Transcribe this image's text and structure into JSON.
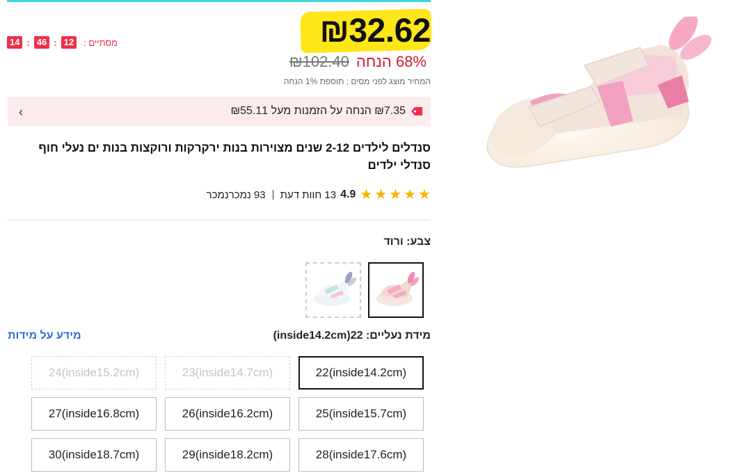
{
  "countdown": {
    "label": "מסתיים :",
    "hours": "14",
    "minutes": "46",
    "seconds": "12"
  },
  "price": {
    "current": "₪32.62",
    "original": "₪102.40",
    "discount": "68% הנחה",
    "tax_note": "המחיר מוצג לפני מסים ; תוספת 1% הנחה"
  },
  "coupon": {
    "text": "₪7.35 הנחה על הזמנות מעל ₪55.11",
    "icon": "tag-icon"
  },
  "product": {
    "title": "סנדלים לילדים 2-12 שנים מצוירות בנות ירקרקות ורוקצות בנות ים נעלי חוף סנדלי ילדים",
    "rating": "4.9",
    "reviews": "13 חוות דעת",
    "sold": "93 נמכרנמכר",
    "stars": 5
  },
  "color": {
    "label": "צבע: ורוד",
    "options": [
      "pink",
      "white-blue"
    ]
  },
  "size": {
    "label": "מידת נעליים: 22(inside14.2cm)",
    "info_link": "מידע על מידות",
    "options": [
      {
        "label": "22(inside14.2cm)",
        "state": "selected"
      },
      {
        "label": "23(inside14.7cm)",
        "state": "disabled"
      },
      {
        "label": "24(inside15.2cm)",
        "state": "disabled"
      },
      {
        "label": "25(inside15.7cm)",
        "state": "normal"
      },
      {
        "label": "26(inside16.2cm)",
        "state": "normal"
      },
      {
        "label": "27(inside16.8cm)",
        "state": "normal"
      },
      {
        "label": "28(inside17.6cm)",
        "state": "normal"
      },
      {
        "label": "29(inside18.2cm)",
        "state": "normal"
      },
      {
        "label": "30(inside18.7cm)",
        "state": "normal"
      }
    ]
  },
  "colors": {
    "accent_red": "#ee3048",
    "highlight": "#ffe619",
    "link": "#2f6fd6",
    "top_line": "#3ed6d9"
  }
}
